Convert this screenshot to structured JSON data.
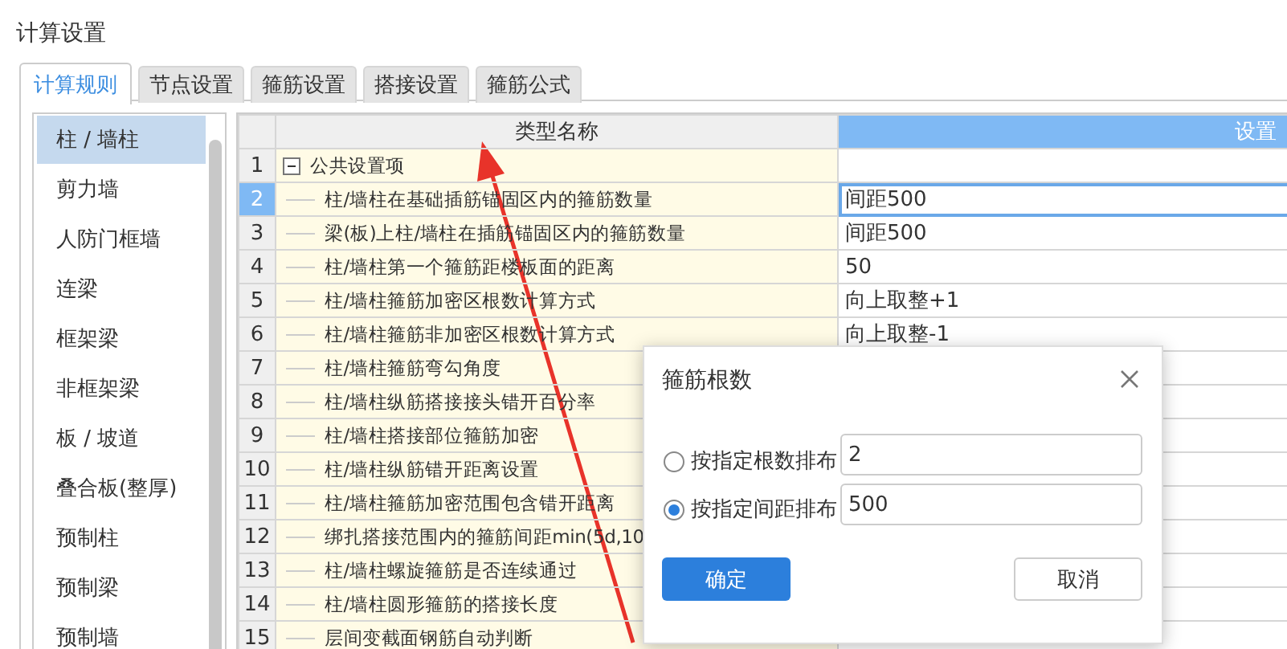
{
  "window": {
    "title": "计算设置"
  },
  "tabs": [
    {
      "label": "计算规则",
      "selected": true
    },
    {
      "label": "节点设置",
      "selected": false
    },
    {
      "label": "箍筋设置",
      "selected": false
    },
    {
      "label": "搭接设置",
      "selected": false
    },
    {
      "label": "箍筋公式",
      "selected": false
    }
  ],
  "sidebar": {
    "items": [
      {
        "label": "柱 / 墙柱",
        "selected": true
      },
      {
        "label": "剪力墙",
        "selected": false
      },
      {
        "label": "人防门框墙",
        "selected": false
      },
      {
        "label": "连梁",
        "selected": false
      },
      {
        "label": "框架梁",
        "selected": false
      },
      {
        "label": "非框架梁",
        "selected": false
      },
      {
        "label": "板 / 坡道",
        "selected": false
      },
      {
        "label": "叠合板(整厚)",
        "selected": false
      },
      {
        "label": "预制柱",
        "selected": false
      },
      {
        "label": "预制梁",
        "selected": false
      },
      {
        "label": "预制墙",
        "selected": false
      }
    ]
  },
  "table": {
    "columns": [
      {
        "label": "类型名称",
        "selected": false
      },
      {
        "label": "设置",
        "selected": true
      }
    ],
    "rows": [
      {
        "num": "1",
        "name": "公共设置项",
        "expanded": true,
        "selected": false,
        "children": [
          {
            "num": "2",
            "name": "柱/墙柱在基础插筋锚固区内的箍筋数量",
            "value": "间距500",
            "selected": true
          },
          {
            "num": "3",
            "name": "梁(板)上柱/墙柱在插筋锚固区内的箍筋数量",
            "value": "间距500",
            "selected": false
          },
          {
            "num": "4",
            "name": "柱/墙柱第一个箍筋距楼板面的距离",
            "value": "50",
            "selected": false
          },
          {
            "num": "5",
            "name": "柱/墙柱箍筋加密区根数计算方式",
            "value": "向上取整+1",
            "selected": false
          },
          {
            "num": "6",
            "name": "柱/墙柱箍筋非加密区根数计算方式",
            "value": "向上取整-1",
            "selected": false
          },
          {
            "num": "7",
            "name": "柱/墙柱箍筋弯勾角度",
            "selected": false
          },
          {
            "num": "8",
            "name": "柱/墙柱纵筋搭接接头错开百分率",
            "selected": false
          },
          {
            "num": "9",
            "name": "柱/墙柱搭接部位箍筋加密",
            "selected": false
          },
          {
            "num": "10",
            "name": "柱/墙柱纵筋错开距离设置",
            "selected": false
          },
          {
            "num": "11",
            "name": "柱/墙柱箍筋加密范围包含错开距离",
            "selected": false
          },
          {
            "num": "12",
            "name": "绑扎搭接范围内的箍筋间距min(5d,10",
            "selected": false
          },
          {
            "num": "13",
            "name": "柱/墙柱螺旋箍筋是否连续通过",
            "selected": false
          },
          {
            "num": "14",
            "name": "柱/墙柱圆形箍筋的搭接长度",
            "selected": false
          },
          {
            "num": "15",
            "name": "层间变截面钢筋自动判断",
            "selected": false
          }
        ]
      }
    ]
  },
  "dialog": {
    "title": "箍筋根数",
    "options": [
      {
        "label": "按指定根数排布",
        "value": "2",
        "selected": false
      },
      {
        "label": "按指定间距排布",
        "value": "500",
        "selected": true
      }
    ],
    "buttons": [
      {
        "label": "确定",
        "kind": "primary"
      },
      {
        "label": "取消",
        "kind": "secondary"
      }
    ]
  }
}
